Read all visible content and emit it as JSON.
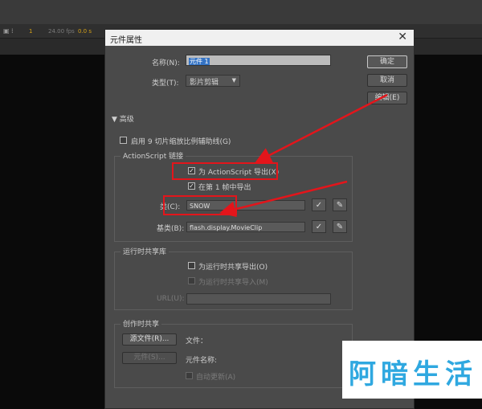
{
  "timeline": {
    "icons": [
      "frame-icon",
      "marker-icon"
    ],
    "frame": "1",
    "fps": "24.00 fps",
    "seconds": "0.0 s"
  },
  "dialog": {
    "title": "元件属性",
    "name_label": "名称(N):",
    "name_value": "元件 1",
    "type_label": "类型(T):",
    "type_value": "影片剪辑",
    "buttons": {
      "ok": "确定",
      "cancel": "取消",
      "edit": "编辑(E)"
    },
    "advanced_label": "高级",
    "scale9_label": "启用 9 切片缩放比例辅助线(G)",
    "as_linkage": {
      "title": "ActionScript 链接",
      "export_as": "为 ActionScript 导出(X)",
      "export_as_checked": true,
      "export_frame1": "在第 1 帧中导出",
      "export_frame1_checked": true,
      "class_label": "类(C):",
      "class_value": "SNOW",
      "base_label": "基类(B):",
      "base_value": "flash.display.MovieClip"
    },
    "runtime_shared": {
      "title": "运行时共享库",
      "export_runtime": "为运行时共享导出(O)",
      "import_runtime": "为运行时共享导入(M)",
      "url_label": "URL(U):",
      "url_value": ""
    },
    "author_shared": {
      "title": "创作时共享",
      "source_button": "源文件(R)...",
      "file_label": "文件：",
      "symbol_button": "元件(S)...",
      "symbol_name_label": "元件名称:",
      "auto_update": "自动更新(A)"
    }
  },
  "watermark": {
    "chars": [
      "阿",
      "暗",
      "生",
      "活"
    ],
    "colors": [
      "#2fa8e0",
      "#2fa8e0",
      "#2fa8e0",
      "#2fa8e0"
    ]
  },
  "colors": {
    "highlight": "#e3151b",
    "dialog_bg": "#4a4a4a",
    "stage": "#0a0a0a"
  }
}
